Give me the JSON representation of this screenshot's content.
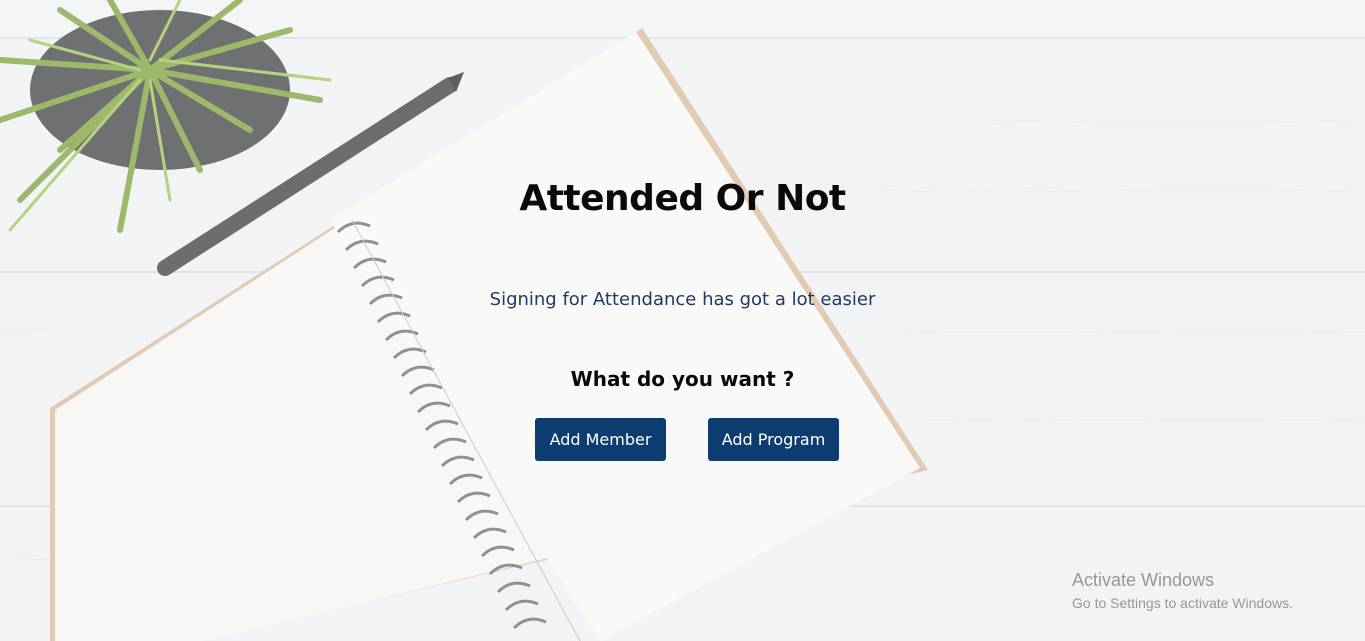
{
  "app": {
    "title": "Attended Or Not",
    "subtitle": "Signing for Attendance has got a lot easier",
    "question": "What do you want ?"
  },
  "actions": {
    "add_member_label": "Add Member",
    "add_program_label": "Add Program"
  },
  "watermark": {
    "line1": "Activate Windows",
    "line2": "Go to Settings to activate Windows."
  },
  "colors": {
    "button_bg": "#0d3d70",
    "subtitle": "#1f3b63",
    "title": "#0a0a0a"
  }
}
